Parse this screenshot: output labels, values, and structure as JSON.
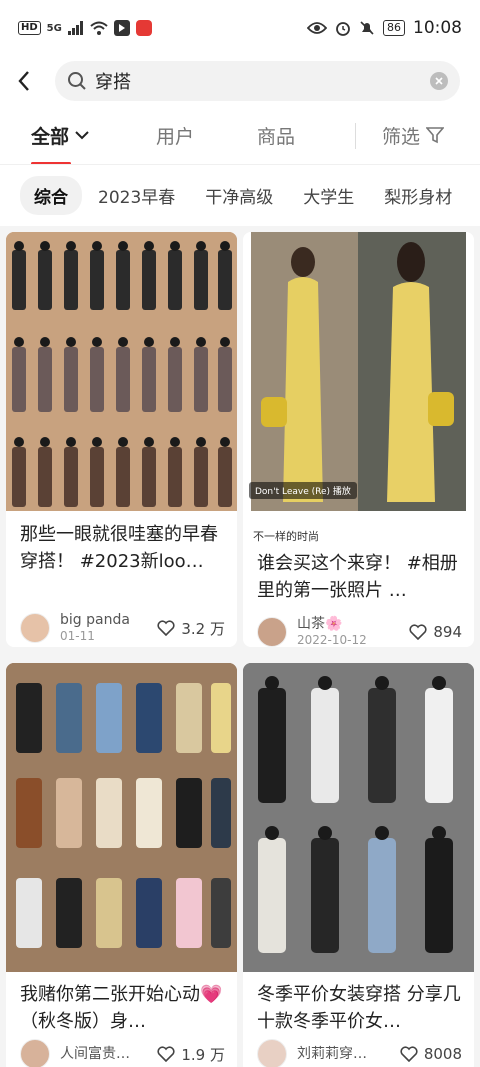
{
  "status": {
    "left_badge": "HD",
    "network": "5G",
    "time": "10:08",
    "battery": "86"
  },
  "search": {
    "query": "穿搭"
  },
  "tabs": [
    {
      "label": "全部"
    },
    {
      "label": "用户"
    },
    {
      "label": "商品"
    },
    {
      "label": "筛选"
    }
  ],
  "chips": [
    "综合",
    "2023早春",
    "干净高级",
    "大学生",
    "梨形身材"
  ],
  "cards": [
    {
      "title": "那些一眼就很哇塞的早春穿搭！ #2023新loo…",
      "author": "big panda",
      "date": "01-11",
      "likes": "3.2 万"
    },
    {
      "tag": "不一样的时尚",
      "overlay": "Don't Leave (Re) 播放",
      "title": "谁会买这个来穿！ #相册里的第一张照片 …",
      "author": "山茶🌸",
      "date": "2022-10-12",
      "likes": "894"
    },
    {
      "title": "我赌你第二张开始心动💗（秋冬版）身…",
      "author": "人间富贵…",
      "likes": "1.9 万"
    },
    {
      "title": "冬季平价女装穿搭 分享几十款冬季平价女…",
      "author": "刘莉莉穿…",
      "likes": "8008"
    }
  ],
  "colors": {
    "accent": "#e33333",
    "card_bg": "#ffffff",
    "page_bg": "#f4f4f4"
  }
}
